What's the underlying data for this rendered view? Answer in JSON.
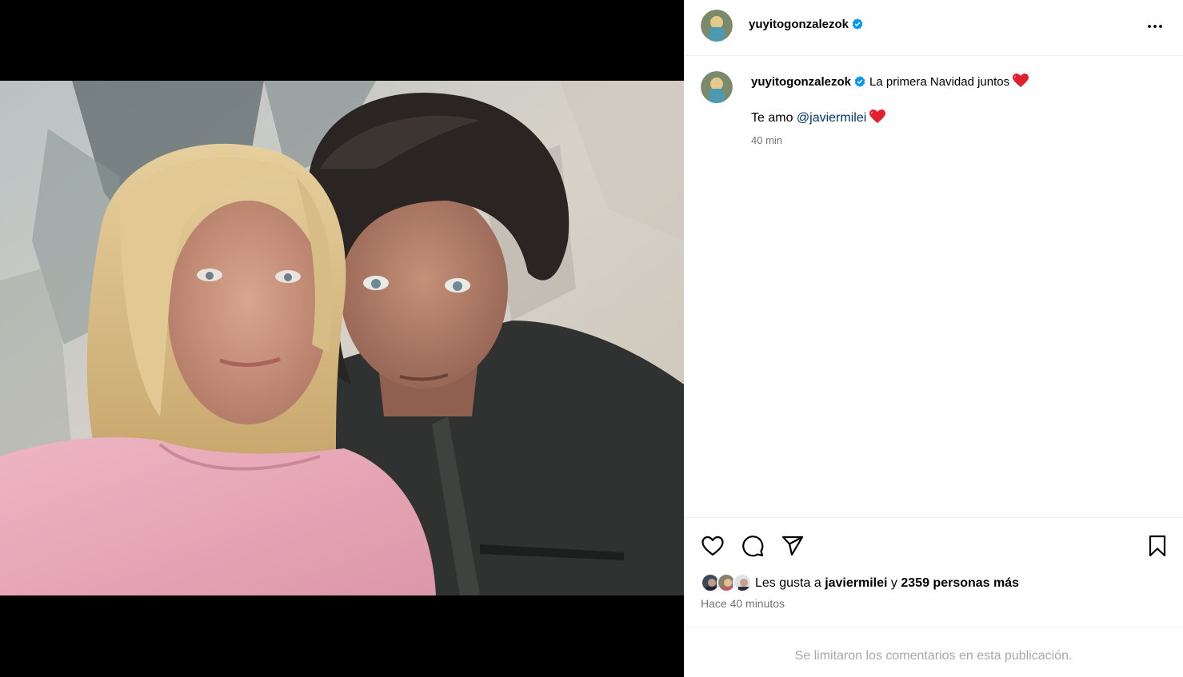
{
  "post": {
    "username": "yuyitogonzalezok",
    "caption_text": "La primera Navidad juntos",
    "caption_line2_prefix": "Te amo",
    "mention": "@javiermilei",
    "caption_time": "40 min",
    "likes_prefix": "Les gusta a",
    "likes_user": "javiermilei",
    "likes_conj": "y",
    "likes_rest": "2359 personas más",
    "post_time": "Hace 40 minutos",
    "comments_limited": "Se limitaron los comentarios en esta publicación."
  },
  "icons": {
    "more": "more-icon",
    "like": "heart-icon",
    "comment": "comment-icon",
    "share": "share-icon",
    "save": "bookmark-icon",
    "verified": "verified-badge-icon",
    "emoji": "red-heart-emoji"
  },
  "colors": {
    "verified": "#0095f6",
    "mention": "#00376b",
    "secondary_text": "#737373",
    "muted_text": "#a8a8a8",
    "heart_emoji": "#e0202e"
  }
}
